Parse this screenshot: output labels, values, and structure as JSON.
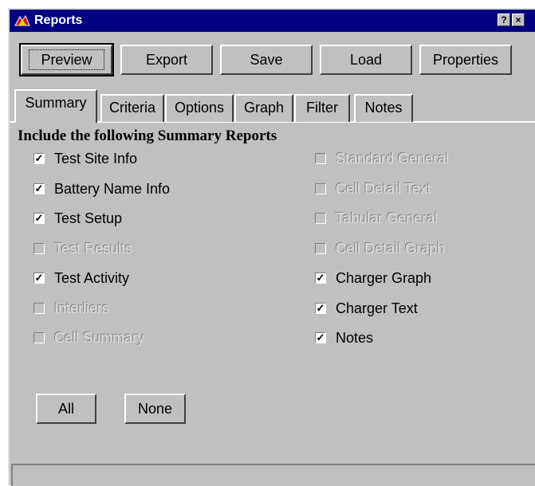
{
  "window": {
    "title": "Reports",
    "help_button": "?",
    "close_button": "×"
  },
  "toolbar": {
    "preview_label": "Preview",
    "export_label": "Export",
    "save_label": "Save",
    "load_label": "Load",
    "properties_label": "Properties"
  },
  "tabs": [
    {
      "label": "Summary",
      "active": true
    },
    {
      "label": "Criteria",
      "active": false
    },
    {
      "label": "Options",
      "active": false
    },
    {
      "label": "Graph",
      "active": false
    },
    {
      "label": "Filter",
      "active": false
    },
    {
      "label": "Notes",
      "active": false
    }
  ],
  "summary": {
    "heading": "Include the following Summary Reports",
    "left_checkboxes": [
      {
        "label": "Test Site Info",
        "checked": true,
        "enabled": true
      },
      {
        "label": "Battery Name Info",
        "checked": true,
        "enabled": true
      },
      {
        "label": "Test Setup",
        "checked": true,
        "enabled": true
      },
      {
        "label": "Test Results",
        "checked": false,
        "enabled": false
      },
      {
        "label": "Test Activity",
        "checked": true,
        "enabled": true
      },
      {
        "label": "Interliers",
        "checked": false,
        "enabled": false
      },
      {
        "label": "Cell Summary",
        "checked": false,
        "enabled": false
      }
    ],
    "right_checkboxes": [
      {
        "label": "Standard General",
        "checked": false,
        "enabled": false
      },
      {
        "label": "Cell Detail Text",
        "checked": false,
        "enabled": false
      },
      {
        "label": "Tabular General",
        "checked": false,
        "enabled": false
      },
      {
        "label": "Cell Detail Graph",
        "checked": false,
        "enabled": false
      },
      {
        "label": "Charger Graph",
        "checked": true,
        "enabled": true
      },
      {
        "label": "Charger Text",
        "checked": true,
        "enabled": true
      },
      {
        "label": "Notes",
        "checked": true,
        "enabled": true
      }
    ],
    "all_label": "All",
    "none_label": "None"
  },
  "status": {
    "text": ""
  },
  "colors": {
    "titlebar": "#000080",
    "face": "#c0c0c0"
  }
}
